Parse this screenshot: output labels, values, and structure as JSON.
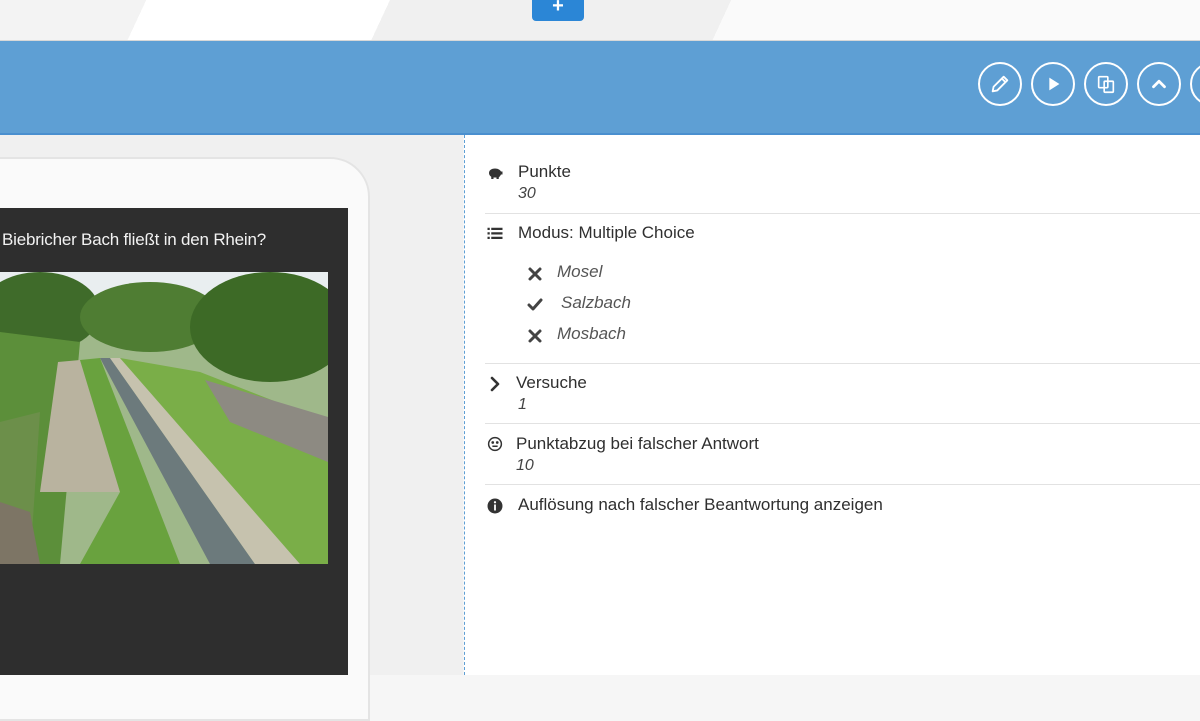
{
  "toolbar": {
    "add_label": "+",
    "accent": "#5e9fd4",
    "buttons": [
      {
        "name": "edit",
        "icon": "pencil-icon"
      },
      {
        "name": "play",
        "icon": "play-icon"
      },
      {
        "name": "copy",
        "icon": "copy-icon"
      },
      {
        "name": "collapse",
        "icon": "chevron-up-icon"
      }
    ]
  },
  "preview": {
    "question": "Biebricher Bach fließt in den Rhein?"
  },
  "details": {
    "points": {
      "label": "Punkte",
      "value": "30",
      "icon": "piggy-bank-icon"
    },
    "mode": {
      "label": "Modus: Multiple Choice",
      "icon": "list-icon",
      "options": [
        {
          "text": "Mosel",
          "correct": false
        },
        {
          "text": "Salzbach",
          "correct": true
        },
        {
          "text": "Mosbach",
          "correct": false
        }
      ]
    },
    "attempts": {
      "label": "Versuche",
      "value": "1",
      "icon": "chevron-right-icon"
    },
    "penalty": {
      "label": "Punktabzug bei falscher Antwort",
      "value": "10",
      "icon": "neutral-face-icon"
    },
    "resolution": {
      "label": "Auflösung nach falscher Beantwortung anzeigen",
      "icon": "info-icon"
    }
  }
}
